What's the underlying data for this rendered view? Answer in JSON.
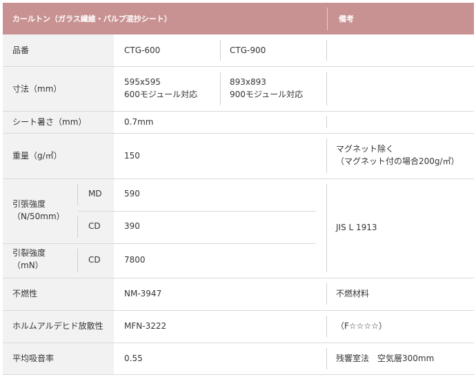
{
  "header": {
    "title": "カールトン（ガラス繊維・パルプ混抄シート）",
    "remarks": "備考"
  },
  "rows": {
    "hinban": {
      "label": "品番",
      "v1": "CTG-600",
      "v2": "CTG-900"
    },
    "sunpou": {
      "label": "寸法（mm）",
      "v1_line1": "595x595",
      "v1_line2": "600モジュール対応",
      "v2_line1": "893x893",
      "v2_line2": "900モジュール対応"
    },
    "thickness": {
      "label": "シート暑さ（mm）",
      "value": "0.7mm"
    },
    "weight": {
      "label": "重量（g/㎡）",
      "value": "150",
      "remark_line1": "マグネット除く",
      "remark_line2": "（マグネット付の場合200g/㎡）"
    },
    "tensile": {
      "label_line1": "引張強度",
      "label_line2": "（N/50mm）",
      "md_label": "MD",
      "md_value": "590",
      "cd_label": "CD",
      "cd_value": "390"
    },
    "tear": {
      "label_line1": "引裂強度",
      "label_line2": "（mN）",
      "cd_label": "CD",
      "cd_value": "7800"
    },
    "strength_remark": "JIS L 1913",
    "nonflammable": {
      "label": "不燃性",
      "value": "NM-3947",
      "remark": "不燃材料"
    },
    "formaldehyde": {
      "label": "ホルムアルデヒド放散性",
      "value": "MFN-3222",
      "remark": "（F☆☆☆☆）"
    },
    "absorption": {
      "label": "平均吸音率",
      "value": "0.55",
      "remark": "残響室法　空気層300mm"
    }
  }
}
